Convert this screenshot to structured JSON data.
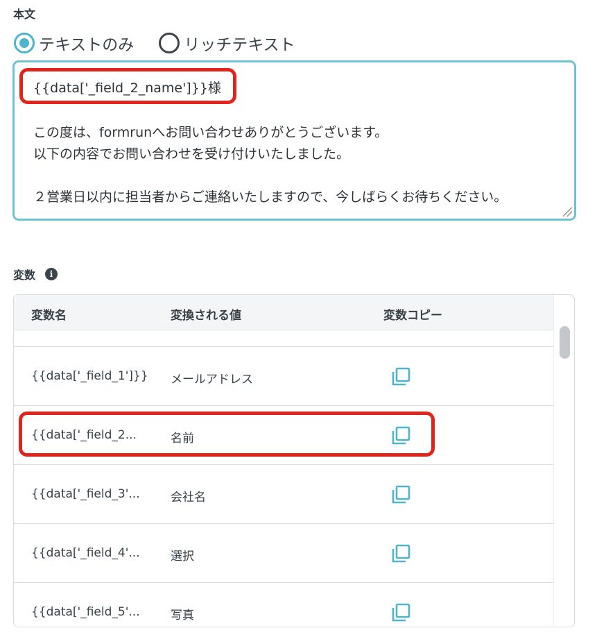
{
  "body_section": {
    "label": "本文",
    "radios": [
      {
        "label": "テキストのみ",
        "checked": true
      },
      {
        "label": "リッチテキスト",
        "checked": false
      }
    ],
    "editor_lines": [
      "{{data['_field_2_name']}}様",
      "この度は、formrunへお問い合わせありがとうございます。",
      "以下の内容でお問い合わせを受け付けいたしました。",
      "",
      "２営業日以内に担当者からご連絡いたしますので、今しばらくお待ちください。"
    ]
  },
  "variables_section": {
    "label": "変数",
    "info_icon": "i",
    "headers": [
      "変数名",
      "変換される値",
      "変数コピー"
    ],
    "rows": [
      {
        "name": "{{data['_field_1']}}",
        "value": "メールアドレス"
      },
      {
        "name": "{{data['_field_2...",
        "value": "名前"
      },
      {
        "name": "{{data['_field_3'...",
        "value": "会社名"
      },
      {
        "name": "{{data['_field_4'...",
        "value": "選択"
      },
      {
        "name": "{{data['_field_5'...",
        "value": "写真"
      }
    ]
  },
  "colors": {
    "accent": "#4fb3cc",
    "highlight": "#e0241b",
    "copy_icon": "#4fb3cc"
  },
  "icons": {
    "copy": "copy-icon",
    "info": "info-icon",
    "resize": "resize-grip-icon"
  }
}
